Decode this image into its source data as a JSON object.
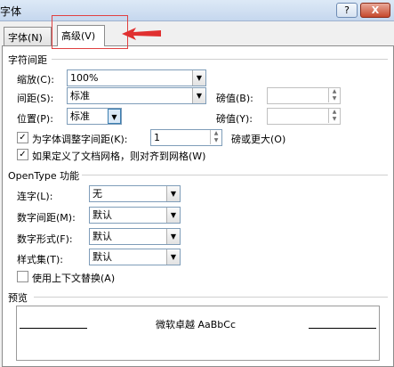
{
  "window": {
    "title": "字体",
    "help_label": "?",
    "close_label": "X"
  },
  "tabs": [
    {
      "label": "字体(N)"
    },
    {
      "label": "高级(V)"
    }
  ],
  "char_spacing": {
    "heading": "字符间距",
    "scale_label": "缩放(C):",
    "scale_value": "100%",
    "spacing_label": "间距(S):",
    "spacing_value": "标准",
    "spacing_by_label": "磅值(B):",
    "spacing_by_value": "",
    "position_label": "位置(P):",
    "position_value": "标准",
    "position_by_label": "磅值(Y):",
    "position_by_value": "",
    "kerning_label": "为字体调整字间距(K):",
    "kerning_checked": true,
    "kerning_value": "1",
    "kerning_suffix": "磅或更大(O)",
    "snap_grid_label": "如果定义了文档网格，则对齐到网格(W)",
    "snap_grid_checked": true
  },
  "opentype": {
    "heading": "OpenType 功能",
    "ligatures_label": "连字(L):",
    "ligatures_value": "无",
    "num_spacing_label": "数字间距(M):",
    "num_spacing_value": "默认",
    "num_forms_label": "数字形式(F):",
    "num_forms_value": "默认",
    "stylistic_label": "样式集(T):",
    "stylistic_value": "默认",
    "contextual_label": "使用上下文替换(A)",
    "contextual_checked": false
  },
  "preview": {
    "heading": "预览",
    "sample_text": "微软卓越 AaBbCc"
  },
  "glyphs": {
    "check": "✓",
    "dropdown": "▼",
    "up": "▲",
    "down": "▼"
  }
}
